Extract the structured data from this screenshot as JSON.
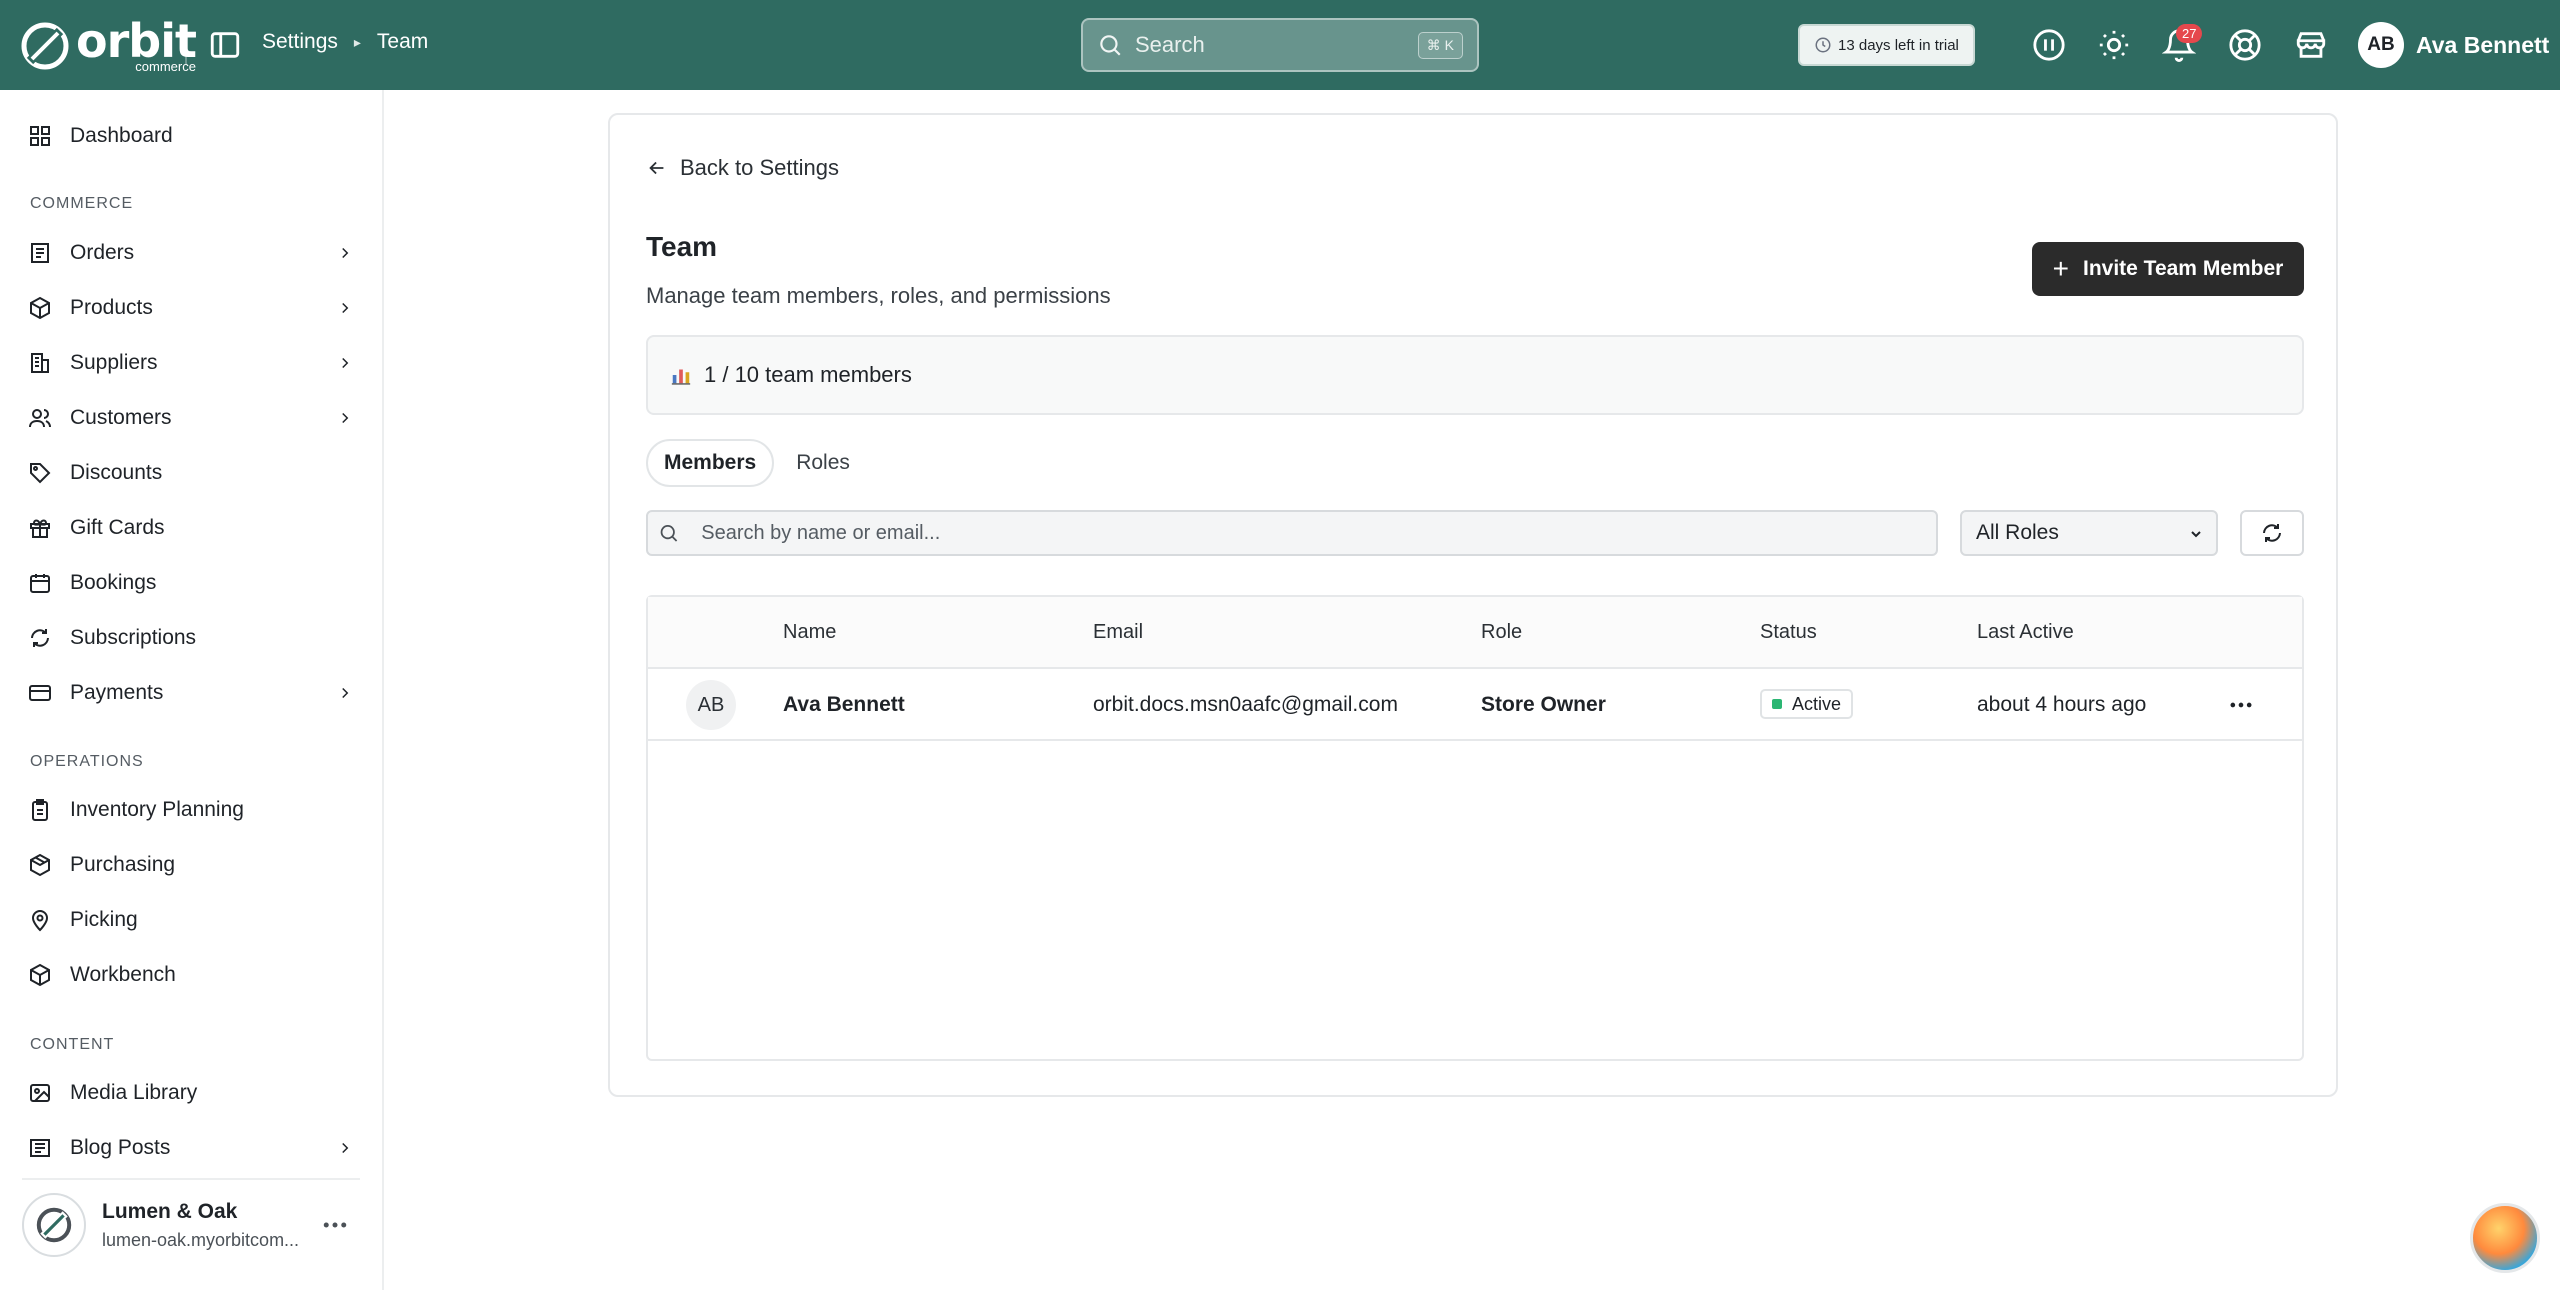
{
  "brand": {
    "name": "orbit",
    "sub": "commerce"
  },
  "breadcrumb": {
    "items": [
      "Settings",
      "Team"
    ]
  },
  "search": {
    "placeholder": "Search",
    "shortcut": "⌘ K"
  },
  "trial": {
    "label": "13 days left in trial"
  },
  "notifications": {
    "count": "27"
  },
  "user": {
    "initials": "AB",
    "name": "Ava Bennett"
  },
  "sidebar": {
    "dashboard": "Dashboard",
    "sections": {
      "commerce": "COMMERCE",
      "operations": "OPERATIONS",
      "content": "CONTENT"
    },
    "commerce_items": [
      "Orders",
      "Products",
      "Suppliers",
      "Customers",
      "Discounts",
      "Gift Cards",
      "Bookings",
      "Subscriptions",
      "Payments"
    ],
    "operations_items": [
      "Inventory Planning",
      "Purchasing",
      "Picking",
      "Workbench"
    ],
    "content_items": [
      "Media Library",
      "Blog Posts"
    ],
    "store": {
      "name": "Lumen & Oak",
      "url": "lumen-oak.myorbitcom..."
    }
  },
  "page": {
    "back_label": "Back to Settings",
    "title": "Team",
    "subtitle": "Manage team members, roles, and permissions",
    "invite_label": "Invite Team Member",
    "usage": "1 / 10 team members",
    "tabs": [
      "Members",
      "Roles"
    ],
    "search_placeholder": "Search by name or email...",
    "roles_filter": "All Roles"
  },
  "table": {
    "columns": [
      "Name",
      "Email",
      "Role",
      "Status",
      "Last Active"
    ],
    "rows": [
      {
        "initials": "AB",
        "name": "Ava Bennett",
        "email": "orbit.docs.msn0aafc@gmail.com",
        "role": "Store Owner",
        "status": "Active",
        "last_active": "about 4 hours ago"
      }
    ]
  },
  "colors": {
    "topbar": "#2f6b61",
    "accent_dark": "#2b2b2b",
    "status_active": "#2bb673",
    "badge": "#e5484d"
  }
}
